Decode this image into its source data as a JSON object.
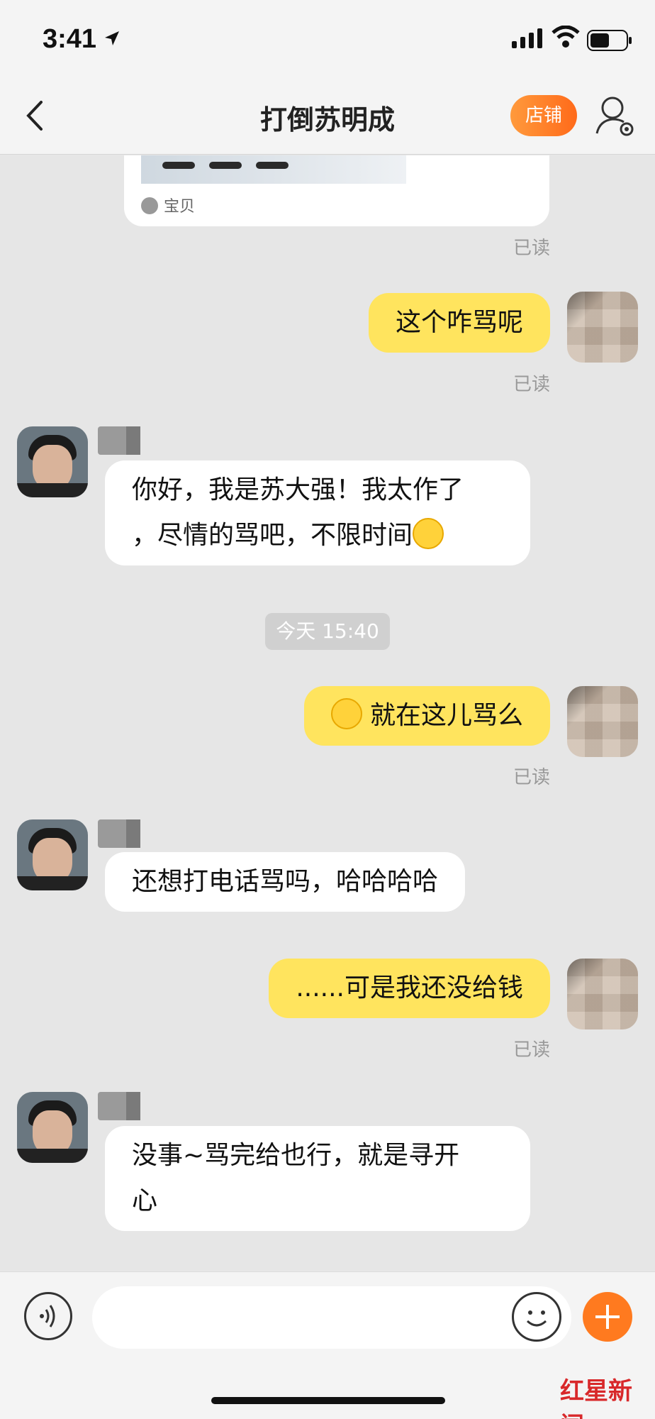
{
  "status_bar": {
    "time": "3:41"
  },
  "nav": {
    "title": "打倒苏明成",
    "store_label": "店铺"
  },
  "product_card": {
    "tag_label": "宝贝"
  },
  "messages": [
    {
      "read": "已读"
    },
    {
      "text": "这个咋骂呢",
      "read": "已读"
    },
    {
      "line1": "你好，我是苏大强！我太作了",
      "line2": "，尽情的骂吧，不限时间"
    },
    {
      "time_chip": "今天 15:40"
    },
    {
      "text": "就在这儿骂么",
      "read": "已读"
    },
    {
      "text": "还想打电话骂吗，哈哈哈哈"
    },
    {
      "text": "......可是我还没给钱",
      "read": "已读"
    },
    {
      "line1": "没事~骂完给也行，就是寻开",
      "line2": "心"
    }
  ],
  "watermark": "红星新闻",
  "colors": {
    "accent": "#ff7a1f",
    "outgoing_bubble": "#ffe45e",
    "incoming_bubble": "#ffffff"
  }
}
